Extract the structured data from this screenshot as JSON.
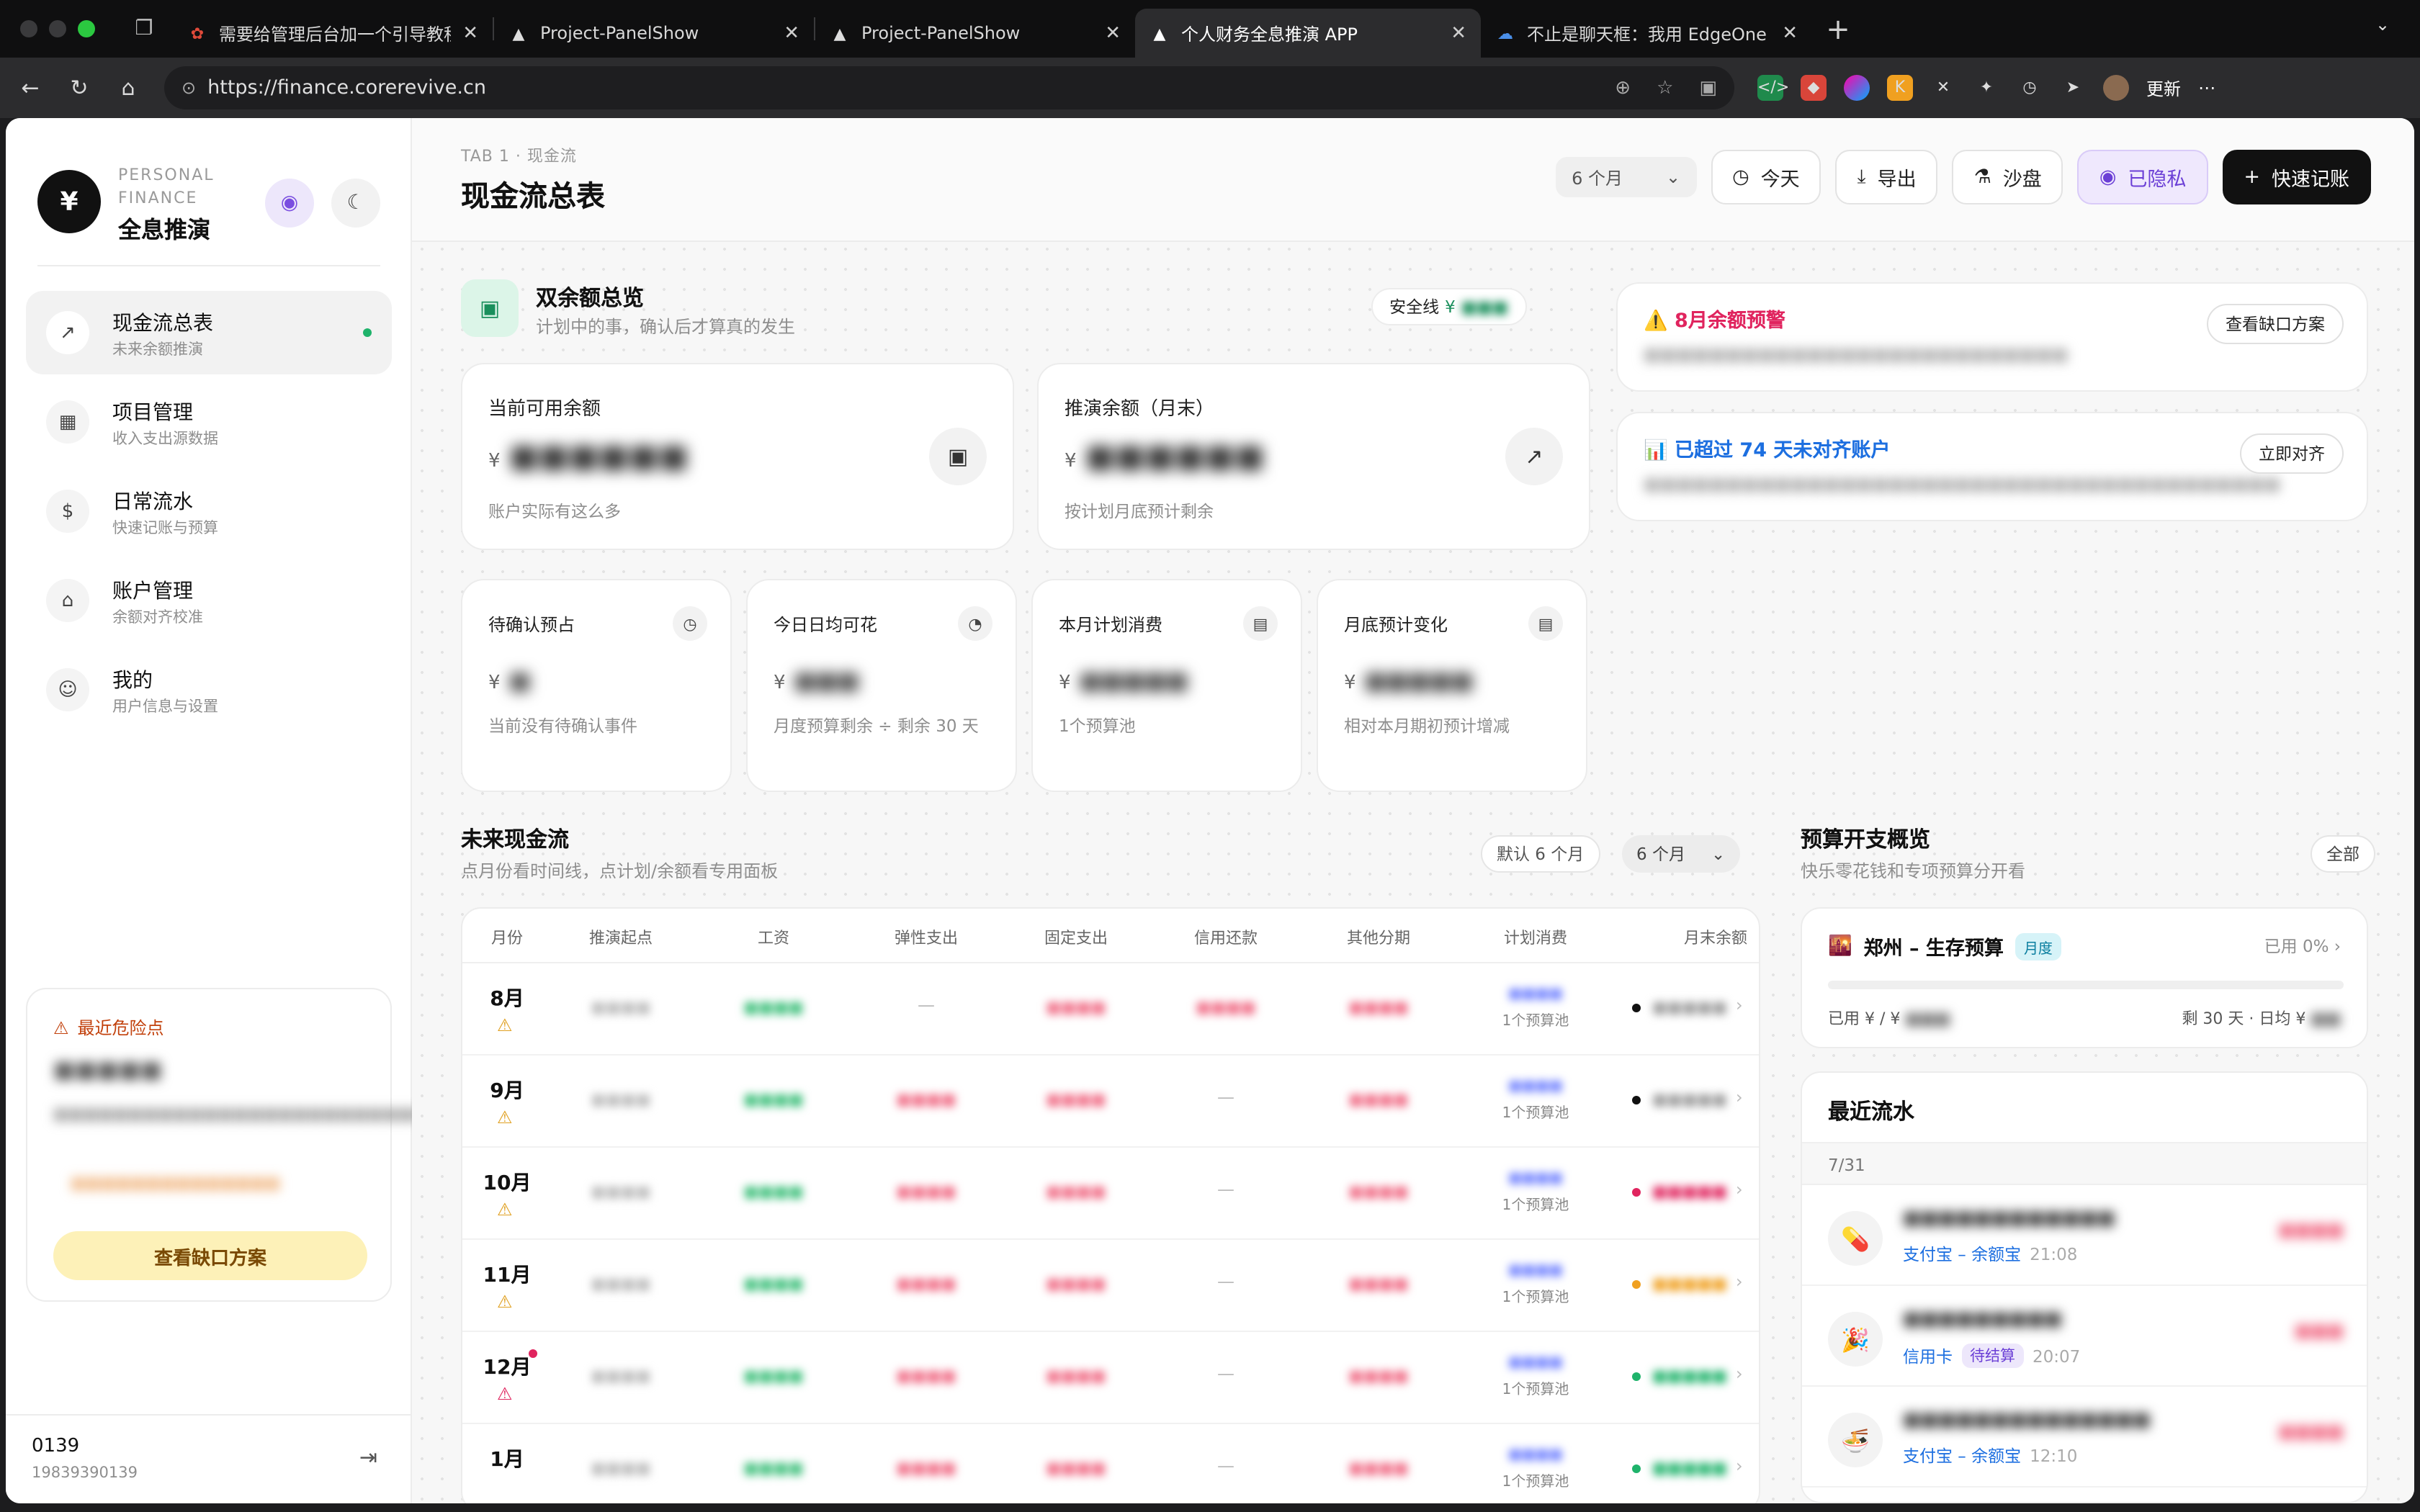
{
  "browser": {
    "tabs": [
      {
        "title": "需要给管理后台加一个引导教程，",
        "active": false
      },
      {
        "title": "Project-PanelShow",
        "active": false
      },
      {
        "title": "Project-PanelShow",
        "active": false
      },
      {
        "title": "个人财务全息推演 APP",
        "active": true
      },
      {
        "title": "不止是聊天框：我用 EdgeOne Ma",
        "active": false
      }
    ],
    "url": "https://finance.corerevive.cn",
    "update_label": "更新"
  },
  "sidebar": {
    "brand_sub": "PERSONAL FINANCE",
    "brand_title": "全息推演",
    "brand_logo": "¥",
    "items": [
      {
        "label": "现金流总表",
        "desc": "未来余额推演",
        "icon": "trend-icon",
        "active": true
      },
      {
        "label": "项目管理",
        "desc": "收入支出源数据",
        "icon": "grid-icon",
        "active": false
      },
      {
        "label": "日常流水",
        "desc": "快速记账与预算",
        "icon": "receipt-icon",
        "active": false
      },
      {
        "label": "账户管理",
        "desc": "余额对齐校准",
        "icon": "bank-icon",
        "active": false
      },
      {
        "label": "我的",
        "desc": "用户信息与设置",
        "icon": "user-icon",
        "active": false
      }
    ],
    "risk": {
      "title": "最近危险点",
      "button": "查看缺口方案"
    },
    "user": {
      "name": "0139",
      "phone": "19839390139"
    }
  },
  "header": {
    "crumb": "TAB 1 · 现金流",
    "title": "现金流总表",
    "range_select": "6 个月",
    "today": "今天",
    "export": "导出",
    "sandbox": "沙盘",
    "privacy": "已隐私",
    "quick_add": "快速记账"
  },
  "overview": {
    "title": "双余额总览",
    "sub": "计划中的事，确认后才算真的发生",
    "safe_label": "安全线",
    "currency": "¥",
    "big_cards": [
      {
        "label": "当前可用余额",
        "foot": "账户实际有这么多",
        "icon": "wallet-icon"
      },
      {
        "label": "推演余额（月末）",
        "foot": "按计划月底预计剩余",
        "icon": "trend-icon"
      }
    ],
    "small_cards": [
      {
        "label": "待确认预占",
        "foot": "当前没有待确认事件",
        "icon": "clock-icon"
      },
      {
        "label": "今日日均可花",
        "foot": "月度预算剩余 ÷ 剩余 30 天",
        "icon": "piggy-icon"
      },
      {
        "label": "本月计划消费",
        "foot": "1个预算池",
        "icon": "doc-icon"
      },
      {
        "label": "月底预计变化",
        "foot": "相对本月期初预计增减",
        "icon": "doc-icon"
      }
    ]
  },
  "alerts": [
    {
      "title": "8月余额预警",
      "button": "查看缺口方案",
      "color": "#e0245e",
      "icon": "⚠️"
    },
    {
      "title": "已超过 74 天未对齐账户",
      "button": "立即对齐",
      "color": "#1d6fe0",
      "icon": "📊"
    }
  ],
  "cashflow": {
    "title": "未来现金流",
    "sub": "点月份看时间线，点计划/余额看专用面板",
    "default_label": "默认 6 个月",
    "range_label": "6 个月",
    "columns": [
      "月份",
      "推演起点",
      "工资",
      "弹性支出",
      "固定支出",
      "信用还款",
      "其他分期",
      "计划消费",
      "月末余额"
    ],
    "pool_label": "1个预算池",
    "rows": [
      {
        "month": "8月",
        "warn": "yellow",
        "flex_dash": true,
        "credit_dash": false,
        "dot": "#111111"
      },
      {
        "month": "9月",
        "warn": "yellow",
        "flex_dash": false,
        "credit_dash": true,
        "dot": "#111111"
      },
      {
        "month": "10月",
        "warn": "yellow",
        "flex_dash": false,
        "credit_dash": true,
        "dot": "#e0245e"
      },
      {
        "month": "11月",
        "warn": "yellow",
        "flex_dash": false,
        "credit_dash": true,
        "dot": "#f0a020"
      },
      {
        "month": "12月",
        "warn": "red",
        "flex_dash": false,
        "credit_dash": true,
        "dot": "#1fb36b"
      },
      {
        "month": "1月",
        "warn": "",
        "flex_dash": false,
        "credit_dash": true,
        "dot": "#1fb36b"
      }
    ]
  },
  "budget": {
    "section_title": "预算开支概览",
    "section_sub": "快乐零花钱和专项预算分开看",
    "all_label": "全部",
    "name": "郑州 – 生存预算",
    "badge": "月度",
    "used_label": "已用 0%",
    "used_fraction": 0,
    "foot": "已用 ¥ / ¥",
    "left": "剩 30 天 · 日均 ¥"
  },
  "recent": {
    "title": "最近流水",
    "date": "7/31",
    "items": [
      {
        "icon": "💊",
        "source": "支付宝 – 余额宝",
        "tag": "",
        "time": "21:08"
      },
      {
        "icon": "🎉",
        "source": "信用卡",
        "tag": "待结算",
        "time": "20:07"
      },
      {
        "icon": "🍜",
        "source": "支付宝 – 余额宝",
        "tag": "",
        "time": "12:10"
      }
    ]
  }
}
